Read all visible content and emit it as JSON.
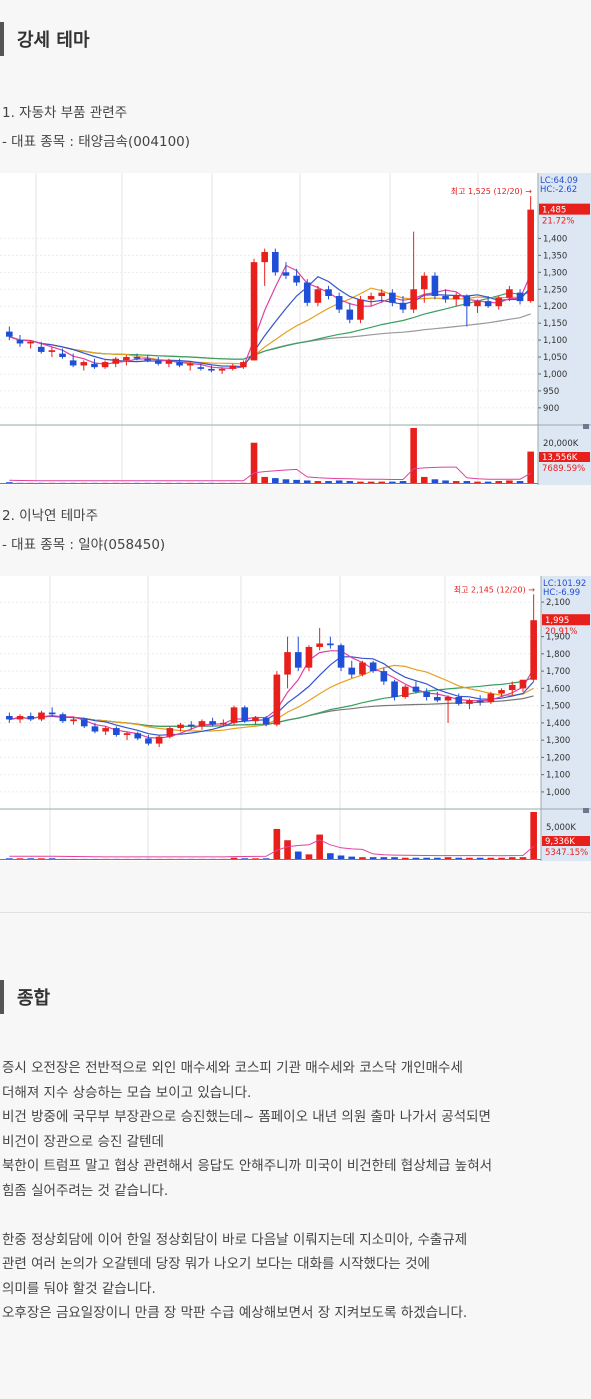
{
  "sections": {
    "strong_theme": "강세 테마",
    "summary_title": "종합"
  },
  "themes": [
    {
      "heading": "1. 자동차 부품 관련주",
      "stock_line": "- 대표 종목 : 태양금속(004100)"
    },
    {
      "heading": "2. 이낙연 테마주",
      "stock_line": "- 대표 종목 : 일야(058450)"
    }
  ],
  "chart_data": [
    {
      "type": "candlestick",
      "stock": "태양금속",
      "annotation": "최고 1,525 (12/20) →",
      "axis_badges": {
        "lc": "LC:64.09",
        "hc": "HC:-2.62",
        "price": "1,485",
        "change": "21.72%"
      },
      "price_ticks": [
        "1,400",
        "1,350",
        "1,300",
        "1,250",
        "1,200",
        "1,150",
        "1,100",
        "1,050",
        "1,000",
        "950",
        "900"
      ],
      "ylim": [
        870,
        1540
      ],
      "volume_ticks": [
        "20,000K"
      ],
      "volume_badges": {
        "vol": "13,556K",
        "ratio": "7689.59%"
      },
      "candles": [
        {
          "o": 1125,
          "h": 1140,
          "l": 1100,
          "c": 1110
        },
        {
          "o": 1100,
          "h": 1115,
          "l": 1080,
          "c": 1090
        },
        {
          "o": 1090,
          "h": 1100,
          "l": 1075,
          "c": 1095
        },
        {
          "o": 1080,
          "h": 1095,
          "l": 1060,
          "c": 1065
        },
        {
          "o": 1065,
          "h": 1080,
          "l": 1050,
          "c": 1070
        },
        {
          "o": 1060,
          "h": 1075,
          "l": 1045,
          "c": 1050
        },
        {
          "o": 1040,
          "h": 1060,
          "l": 1020,
          "c": 1025
        },
        {
          "o": 1025,
          "h": 1040,
          "l": 1010,
          "c": 1035
        },
        {
          "o": 1030,
          "h": 1045,
          "l": 1015,
          "c": 1020
        },
        {
          "o": 1020,
          "h": 1040,
          "l": 1015,
          "c": 1035
        },
        {
          "o": 1030,
          "h": 1050,
          "l": 1020,
          "c": 1045
        },
        {
          "o": 1040,
          "h": 1055,
          "l": 1025,
          "c": 1050
        },
        {
          "o": 1050,
          "h": 1060,
          "l": 1040,
          "c": 1045
        },
        {
          "o": 1045,
          "h": 1055,
          "l": 1035,
          "c": 1040
        },
        {
          "o": 1040,
          "h": 1050,
          "l": 1025,
          "c": 1030
        },
        {
          "o": 1030,
          "h": 1045,
          "l": 1020,
          "c": 1040
        },
        {
          "o": 1035,
          "h": 1045,
          "l": 1020,
          "c": 1025
        },
        {
          "o": 1025,
          "h": 1035,
          "l": 1010,
          "c": 1030
        },
        {
          "o": 1020,
          "h": 1030,
          "l": 1010,
          "c": 1015
        },
        {
          "o": 1015,
          "h": 1025,
          "l": 1005,
          "c": 1010
        },
        {
          "o": 1010,
          "h": 1020,
          "l": 1000,
          "c": 1015
        },
        {
          "o": 1015,
          "h": 1030,
          "l": 1010,
          "c": 1025
        },
        {
          "o": 1020,
          "h": 1040,
          "l": 1015,
          "c": 1035
        },
        {
          "o": 1040,
          "h": 1340,
          "l": 1040,
          "c": 1330
        },
        {
          "o": 1330,
          "h": 1370,
          "l": 1260,
          "c": 1360
        },
        {
          "o": 1360,
          "h": 1370,
          "l": 1290,
          "c": 1300
        },
        {
          "o": 1300,
          "h": 1330,
          "l": 1280,
          "c": 1290
        },
        {
          "o": 1290,
          "h": 1310,
          "l": 1260,
          "c": 1270
        },
        {
          "o": 1270,
          "h": 1280,
          "l": 1200,
          "c": 1210
        },
        {
          "o": 1210,
          "h": 1260,
          "l": 1200,
          "c": 1250
        },
        {
          "o": 1250,
          "h": 1260,
          "l": 1220,
          "c": 1230
        },
        {
          "o": 1230,
          "h": 1240,
          "l": 1180,
          "c": 1190
        },
        {
          "o": 1190,
          "h": 1210,
          "l": 1150,
          "c": 1160
        },
        {
          "o": 1160,
          "h": 1230,
          "l": 1150,
          "c": 1220
        },
        {
          "o": 1220,
          "h": 1240,
          "l": 1200,
          "c": 1230
        },
        {
          "o": 1230,
          "h": 1250,
          "l": 1210,
          "c": 1240
        },
        {
          "o": 1240,
          "h": 1250,
          "l": 1200,
          "c": 1210
        },
        {
          "o": 1210,
          "h": 1230,
          "l": 1180,
          "c": 1190
        },
        {
          "o": 1190,
          "h": 1420,
          "l": 1180,
          "c": 1250
        },
        {
          "o": 1250,
          "h": 1300,
          "l": 1210,
          "c": 1290
        },
        {
          "o": 1290,
          "h": 1300,
          "l": 1220,
          "c": 1230
        },
        {
          "o": 1230,
          "h": 1250,
          "l": 1210,
          "c": 1220
        },
        {
          "o": 1220,
          "h": 1240,
          "l": 1200,
          "c": 1230
        },
        {
          "o": 1230,
          "h": 1235,
          "l": 1140,
          "c": 1200
        },
        {
          "o": 1200,
          "h": 1220,
          "l": 1180,
          "c": 1215
        },
        {
          "o": 1215,
          "h": 1230,
          "l": 1195,
          "c": 1200
        },
        {
          "o": 1200,
          "h": 1230,
          "l": 1190,
          "c": 1225
        },
        {
          "o": 1225,
          "h": 1260,
          "l": 1215,
          "c": 1250
        },
        {
          "o": 1240,
          "h": 1250,
          "l": 1205,
          "c": 1215
        },
        {
          "o": 1215,
          "h": 1525,
          "l": 1210,
          "c": 1485
        }
      ],
      "volume": [
        0.03,
        0.02,
        0.02,
        0.02,
        0.02,
        0.02,
        0.02,
        0.02,
        0.02,
        0.02,
        0.02,
        0.02,
        0.02,
        0.02,
        0.02,
        0.02,
        0.02,
        0.02,
        0.02,
        0.02,
        0.02,
        0.02,
        0.02,
        0.7,
        0.12,
        0.1,
        0.08,
        0.07,
        0.06,
        0.05,
        0.05,
        0.06,
        0.05,
        0.04,
        0.04,
        0.04,
        0.04,
        0.05,
        0.95,
        0.12,
        0.08,
        0.06,
        0.05,
        0.05,
        0.04,
        0.04,
        0.05,
        0.06,
        0.05,
        0.55
      ],
      "ma_colors": {
        "ma5": "#e040a0",
        "ma10": "#3355cc",
        "ma20": "#e6a020",
        "ma60": "#3aa060",
        "ma120": "#999999"
      }
    },
    {
      "type": "candlestick",
      "stock": "일야",
      "annotation": "최고 2,145 (12/20) →",
      "axis_badges": {
        "lc": "LC:101.92",
        "hc": "HC:-6.99",
        "price": "1,995",
        "change": "20.91%"
      },
      "price_ticks": [
        "2,100",
        "1,900",
        "1,800",
        "1,700",
        "1,600",
        "1,500",
        "1,400",
        "1,300",
        "1,200",
        "1,100",
        "1,000"
      ],
      "ylim": [
        930,
        2170
      ],
      "volume_ticks": [
        "5,000K"
      ],
      "volume_badges": {
        "vol": "9,336K",
        "ratio": "5347.15%"
      },
      "candles": [
        {
          "o": 1440,
          "h": 1460,
          "l": 1400,
          "c": 1420
        },
        {
          "o": 1420,
          "h": 1450,
          "l": 1400,
          "c": 1440
        },
        {
          "o": 1440,
          "h": 1460,
          "l": 1410,
          "c": 1420
        },
        {
          "o": 1420,
          "h": 1470,
          "l": 1410,
          "c": 1460
        },
        {
          "o": 1460,
          "h": 1490,
          "l": 1440,
          "c": 1450
        },
        {
          "o": 1450,
          "h": 1460,
          "l": 1400,
          "c": 1410
        },
        {
          "o": 1410,
          "h": 1430,
          "l": 1390,
          "c": 1420
        },
        {
          "o": 1420,
          "h": 1430,
          "l": 1370,
          "c": 1380
        },
        {
          "o": 1380,
          "h": 1400,
          "l": 1340,
          "c": 1350
        },
        {
          "o": 1350,
          "h": 1380,
          "l": 1330,
          "c": 1370
        },
        {
          "o": 1370,
          "h": 1380,
          "l": 1320,
          "c": 1330
        },
        {
          "o": 1330,
          "h": 1350,
          "l": 1300,
          "c": 1340
        },
        {
          "o": 1340,
          "h": 1350,
          "l": 1300,
          "c": 1310
        },
        {
          "o": 1310,
          "h": 1330,
          "l": 1270,
          "c": 1280
        },
        {
          "o": 1280,
          "h": 1330,
          "l": 1260,
          "c": 1320
        },
        {
          "o": 1320,
          "h": 1380,
          "l": 1310,
          "c": 1370
        },
        {
          "o": 1370,
          "h": 1400,
          "l": 1350,
          "c": 1390
        },
        {
          "o": 1390,
          "h": 1410,
          "l": 1360,
          "c": 1380
        },
        {
          "o": 1380,
          "h": 1420,
          "l": 1360,
          "c": 1410
        },
        {
          "o": 1410,
          "h": 1430,
          "l": 1380,
          "c": 1390
        },
        {
          "o": 1390,
          "h": 1420,
          "l": 1380,
          "c": 1400
        },
        {
          "o": 1400,
          "h": 1500,
          "l": 1390,
          "c": 1490
        },
        {
          "o": 1490,
          "h": 1500,
          "l": 1400,
          "c": 1410
        },
        {
          "o": 1410,
          "h": 1440,
          "l": 1390,
          "c": 1430
        },
        {
          "o": 1430,
          "h": 1440,
          "l": 1380,
          "c": 1390
        },
        {
          "o": 1390,
          "h": 1700,
          "l": 1380,
          "c": 1680
        },
        {
          "o": 1680,
          "h": 1900,
          "l": 1600,
          "c": 1810
        },
        {
          "o": 1810,
          "h": 1900,
          "l": 1700,
          "c": 1720
        },
        {
          "o": 1720,
          "h": 1850,
          "l": 1700,
          "c": 1840
        },
        {
          "o": 1840,
          "h": 1950,
          "l": 1820,
          "c": 1860
        },
        {
          "o": 1860,
          "h": 1900,
          "l": 1830,
          "c": 1850
        },
        {
          "o": 1850,
          "h": 1860,
          "l": 1700,
          "c": 1720
        },
        {
          "o": 1720,
          "h": 1760,
          "l": 1660,
          "c": 1680
        },
        {
          "o": 1680,
          "h": 1760,
          "l": 1670,
          "c": 1750
        },
        {
          "o": 1750,
          "h": 1760,
          "l": 1690,
          "c": 1700
        },
        {
          "o": 1700,
          "h": 1720,
          "l": 1620,
          "c": 1640
        },
        {
          "o": 1640,
          "h": 1650,
          "l": 1530,
          "c": 1550
        },
        {
          "o": 1550,
          "h": 1620,
          "l": 1540,
          "c": 1610
        },
        {
          "o": 1610,
          "h": 1640,
          "l": 1570,
          "c": 1580
        },
        {
          "o": 1580,
          "h": 1600,
          "l": 1530,
          "c": 1550
        },
        {
          "o": 1550,
          "h": 1580,
          "l": 1520,
          "c": 1530
        },
        {
          "o": 1530,
          "h": 1560,
          "l": 1400,
          "c": 1550
        },
        {
          "o": 1550,
          "h": 1570,
          "l": 1500,
          "c": 1510
        },
        {
          "o": 1510,
          "h": 1540,
          "l": 1480,
          "c": 1530
        },
        {
          "o": 1530,
          "h": 1560,
          "l": 1500,
          "c": 1520
        },
        {
          "o": 1520,
          "h": 1580,
          "l": 1510,
          "c": 1570
        },
        {
          "o": 1570,
          "h": 1600,
          "l": 1550,
          "c": 1590
        },
        {
          "o": 1590,
          "h": 1640,
          "l": 1560,
          "c": 1620
        },
        {
          "o": 1600,
          "h": 1650,
          "l": 1580,
          "c": 1650
        },
        {
          "o": 1650,
          "h": 2145,
          "l": 1640,
          "c": 1995
        }
      ],
      "volume": [
        0.03,
        0.03,
        0.03,
        0.03,
        0.03,
        0.02,
        0.02,
        0.02,
        0.02,
        0.02,
        0.02,
        0.02,
        0.02,
        0.02,
        0.02,
        0.02,
        0.02,
        0.02,
        0.02,
        0.02,
        0.02,
        0.04,
        0.03,
        0.03,
        0.03,
        0.55,
        0.35,
        0.15,
        0.1,
        0.45,
        0.12,
        0.08,
        0.06,
        0.05,
        0.05,
        0.05,
        0.05,
        0.04,
        0.04,
        0.04,
        0.04,
        0.05,
        0.04,
        0.04,
        0.04,
        0.04,
        0.04,
        0.05,
        0.05,
        0.85
      ],
      "ma_colors": {
        "ma5": "#e040a0",
        "ma10": "#3355cc",
        "ma20": "#e6a020",
        "ma60": "#3aa060",
        "ma120": "#777777"
      }
    }
  ],
  "summary": [
    "증시 오전장은 전반적으로 외인 매수세와 코스피 기관 매수세와 코스닥 개인매수세",
    "더해져 지수 상승하는 모습 보이고 있습니다.",
    "비건 방중에 국무부 부장관으로 승진했는데~ 폼페이오 내년 의원 출마 나가서 공석되면",
    "비건이 장관으로 승진 갈텐데",
    "북한이 트럼프 말고 협상 관련해서 응답도 안해주니까 미국이 비건한테 협상체급 높혀서",
    "힘좀 실어주려는 것 같습니다.",
    "",
    "한중 정상회담에 이어 한일 정상회담이 바로 다음날 이뤄지는데 지소미아, 수출규제",
    "관련 여러 논의가 오갈텐데 당장 뭐가 나오기 보다는 대화를 시작했다는 것에",
    "의미를 둬야 할것 같습니다.",
    "오후장은 금요일장이니 만큼 장 막판 수급 예상해보면서 장 지켜보도록 하겠습니다."
  ]
}
